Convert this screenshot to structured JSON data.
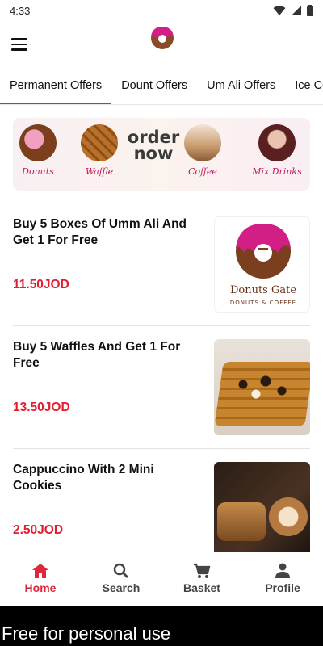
{
  "status": {
    "time": "4:33"
  },
  "app": {
    "brand": "Donuts Gate",
    "brand_sub": "DONUTS & COFFEE"
  },
  "tabs": [
    {
      "label": "Permanent Offers",
      "active": true
    },
    {
      "label": "Dount Offers"
    },
    {
      "label": "Um Ali Offers"
    },
    {
      "label": "Ice Coffee"
    }
  ],
  "banner": {
    "headline": "order now",
    "items": [
      {
        "label": "Donuts"
      },
      {
        "label": "Waffle"
      },
      {
        "label": "Coffee"
      },
      {
        "label": "Mix Drinks"
      }
    ]
  },
  "offers": [
    {
      "title": "Buy 5 Boxes Of Umm Ali And Get 1 For Free",
      "price": "11.50JOD",
      "image": "donuts-gate-logo"
    },
    {
      "title": "Buy 5 Waffles And Get 1 For Free",
      "price": "13.50JOD",
      "image": "waffle-photo"
    },
    {
      "title": "Cappuccino With 2 Mini Cookies",
      "price": "2.50JOD",
      "image": "cappuccino-photo"
    }
  ],
  "bottom_nav": [
    {
      "label": "Home",
      "icon": "home-icon",
      "active": true
    },
    {
      "label": "Search",
      "icon": "search-icon"
    },
    {
      "label": "Basket",
      "icon": "basket-icon"
    },
    {
      "label": "Profile",
      "icon": "profile-icon"
    }
  ],
  "watermark": "Free for personal use",
  "colors": {
    "accent": "#e0263a",
    "price": "#e11d2f"
  }
}
